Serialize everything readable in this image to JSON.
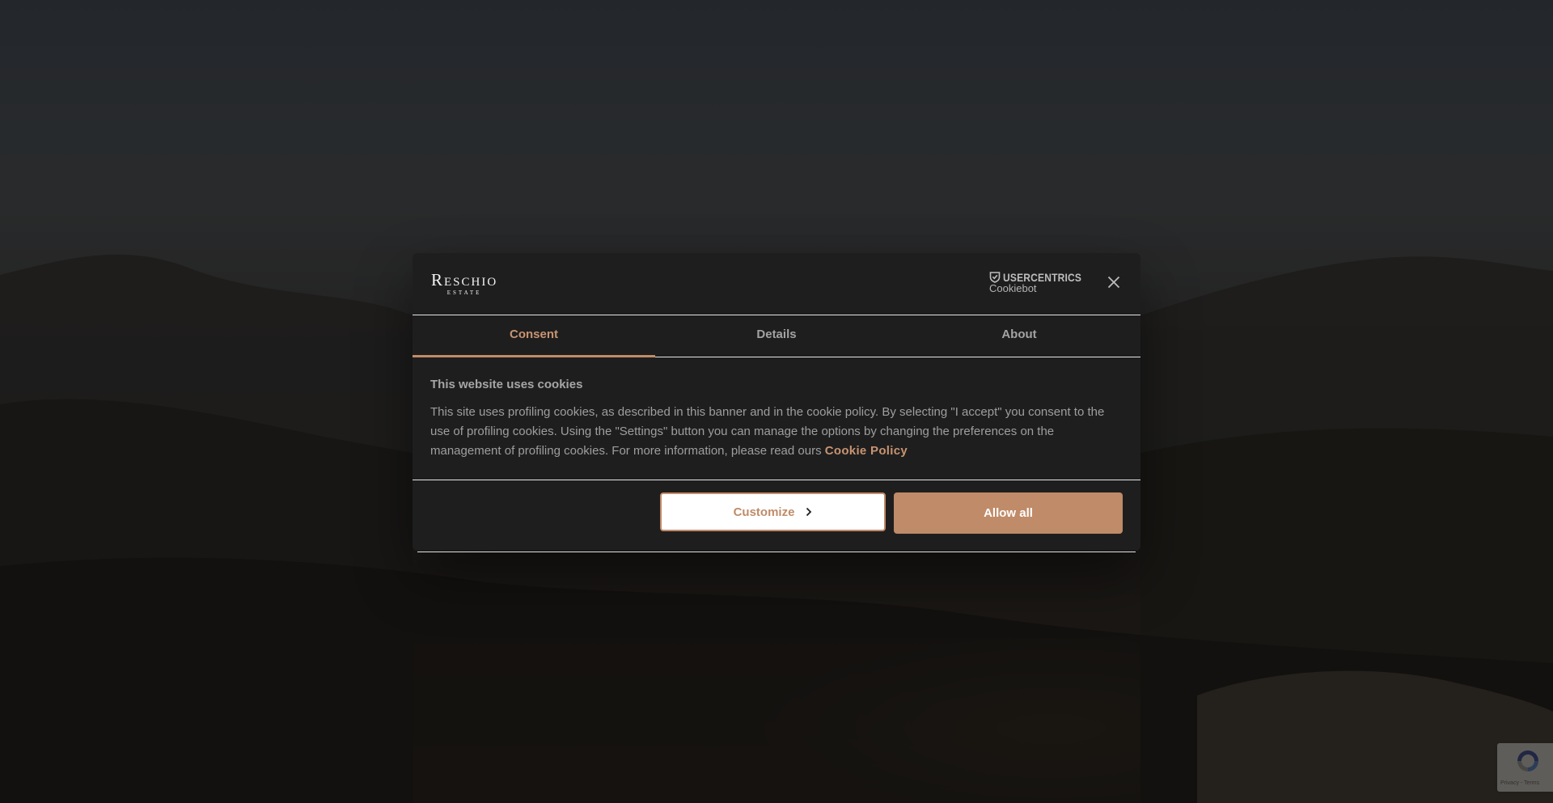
{
  "header": {
    "logo_main": "Reschio",
    "logo_sub": "ESTATE",
    "brand_name": "USERCENTRICS",
    "brand_product": "Cookiebot"
  },
  "tabs": [
    {
      "label": "Consent",
      "active": true
    },
    {
      "label": "Details",
      "active": false
    },
    {
      "label": "About",
      "active": false
    }
  ],
  "content": {
    "title": "This website uses cookies",
    "text": "This site uses profiling cookies, as described in this banner and in the cookie policy. By selecting \"I accept\" you consent to the use of profiling cookies. Using the \"Settings\" button you can manage the options by changing the preferences on the management of profiling cookies. For more information, please read ours ",
    "link_label": "Cookie Policy"
  },
  "buttons": {
    "customize_label": "Customize",
    "allow_all_label": "Allow all"
  },
  "recaptcha": {
    "links": "Privacy - Terms"
  },
  "colors": {
    "accent": "#c08b68",
    "dialog_bg": "#1f1e1e"
  }
}
